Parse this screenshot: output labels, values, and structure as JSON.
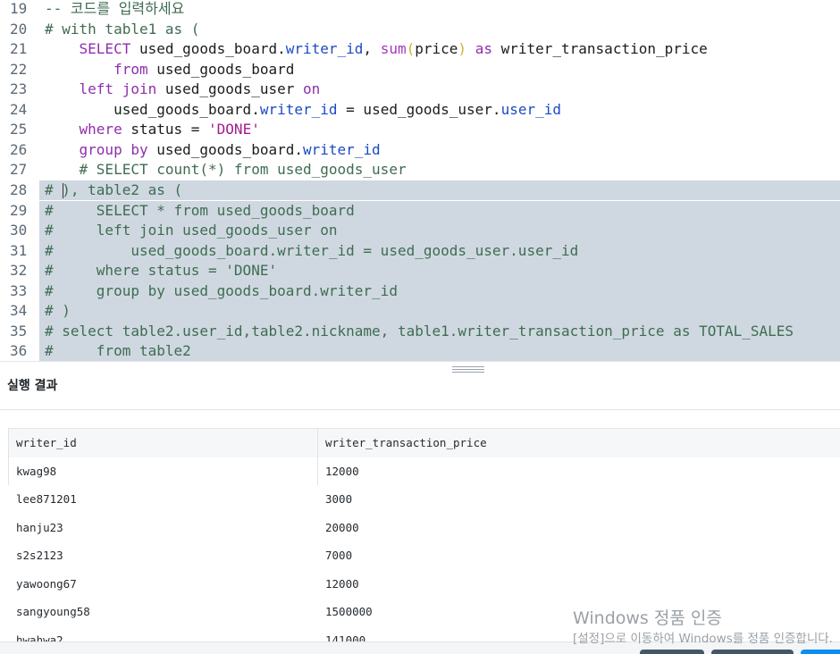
{
  "editor": {
    "lines": [
      {
        "num": "19",
        "tokens": [
          {
            "t": "-- 코드를 입력하세요",
            "c": "comment"
          }
        ]
      },
      {
        "num": "20",
        "tokens": [
          {
            "t": "# with table1 as (",
            "c": "comment"
          }
        ]
      },
      {
        "num": "21",
        "tokens": [
          {
            "t": "    ",
            "c": "plain"
          },
          {
            "t": "SELECT",
            "c": "keyword"
          },
          {
            "t": " used_goods_board.",
            "c": "plain"
          },
          {
            "t": "writer_id",
            "c": "prop"
          },
          {
            "t": ", ",
            "c": "plain"
          },
          {
            "t": "sum",
            "c": "func"
          },
          {
            "t": "(",
            "c": "paren"
          },
          {
            "t": "price",
            "c": "plain"
          },
          {
            "t": ")",
            "c": "paren"
          },
          {
            "t": " ",
            "c": "plain"
          },
          {
            "t": "as",
            "c": "keyword"
          },
          {
            "t": " writer_transaction_price",
            "c": "plain"
          }
        ]
      },
      {
        "num": "22",
        "tokens": [
          {
            "t": "        ",
            "c": "plain"
          },
          {
            "t": "from",
            "c": "keyword"
          },
          {
            "t": " used_goods_board",
            "c": "plain"
          }
        ]
      },
      {
        "num": "23",
        "tokens": [
          {
            "t": "    ",
            "c": "plain"
          },
          {
            "t": "left join",
            "c": "keyword"
          },
          {
            "t": " used_goods_user ",
            "c": "plain"
          },
          {
            "t": "on",
            "c": "keyword"
          }
        ]
      },
      {
        "num": "24",
        "tokens": [
          {
            "t": "        used_goods_board.",
            "c": "plain"
          },
          {
            "t": "writer_id",
            "c": "prop"
          },
          {
            "t": " = used_goods_user.",
            "c": "plain"
          },
          {
            "t": "user_id",
            "c": "prop"
          }
        ]
      },
      {
        "num": "25",
        "tokens": [
          {
            "t": "    ",
            "c": "plain"
          },
          {
            "t": "where",
            "c": "keyword"
          },
          {
            "t": " status = ",
            "c": "plain"
          },
          {
            "t": "'DONE'",
            "c": "string"
          }
        ]
      },
      {
        "num": "26",
        "tokens": [
          {
            "t": "    ",
            "c": "plain"
          },
          {
            "t": "group by",
            "c": "keyword"
          },
          {
            "t": " used_goods_board.",
            "c": "plain"
          },
          {
            "t": "writer_id",
            "c": "prop"
          }
        ]
      },
      {
        "num": "27",
        "tokens": [
          {
            "t": "    # SELECT count(*) from used_goods_user",
            "c": "comment"
          }
        ]
      },
      {
        "num": "28",
        "selected": true,
        "cursor": true,
        "tokens": [
          {
            "t": "# ), table2 as (",
            "c": "comment"
          }
        ]
      },
      {
        "num": "29",
        "selected": true,
        "tokens": [
          {
            "t": "#     SELECT * from used_goods_board",
            "c": "comment"
          }
        ]
      },
      {
        "num": "30",
        "selected": true,
        "tokens": [
          {
            "t": "#     left join used_goods_user on",
            "c": "comment"
          }
        ]
      },
      {
        "num": "31",
        "selected": true,
        "tokens": [
          {
            "t": "#         used_goods_board.writer_id = used_goods_user.user_id",
            "c": "comment"
          }
        ]
      },
      {
        "num": "32",
        "selected": true,
        "tokens": [
          {
            "t": "#     where status = 'DONE'",
            "c": "comment"
          }
        ]
      },
      {
        "num": "33",
        "selected": true,
        "tokens": [
          {
            "t": "#     group by used_goods_board.writer_id",
            "c": "comment"
          }
        ]
      },
      {
        "num": "34",
        "selected": true,
        "tokens": [
          {
            "t": "# )",
            "c": "comment"
          }
        ]
      },
      {
        "num": "35",
        "selected": true,
        "tokens": [
          {
            "t": "# select table2.user_id,table2.nickname, table1.writer_transaction_price as TOTAL_SALES",
            "c": "comment"
          }
        ]
      },
      {
        "num": "36",
        "selected": true,
        "tokens": [
          {
            "t": "#     from table2",
            "c": "comment"
          }
        ]
      }
    ]
  },
  "result": {
    "title": "실행 결과",
    "columns": [
      "writer_id",
      "writer_transaction_price"
    ],
    "rows": [
      [
        "kwag98",
        "12000"
      ],
      [
        "lee871201",
        "3000"
      ],
      [
        "hanju23",
        "20000"
      ],
      [
        "s2s2123",
        "7000"
      ],
      [
        "yawoong67",
        "12000"
      ],
      [
        "sangyoung58",
        "1500000"
      ],
      [
        "hwahwa2",
        "141000"
      ]
    ]
  },
  "watermark": {
    "title": "Windows 정품 인증",
    "subtitle": "[설정]으로 이동하여 Windows를 정품 인증합니다."
  }
}
